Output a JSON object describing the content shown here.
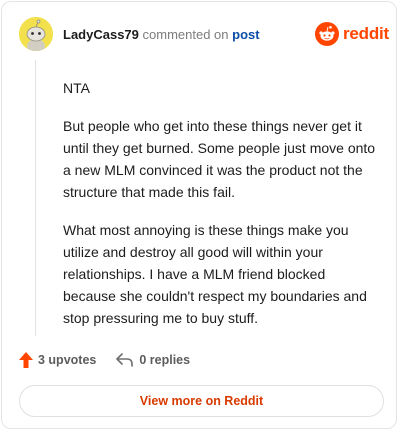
{
  "header": {
    "username": "LadyCass79",
    "action": "commented on",
    "post_link": "post"
  },
  "logo": {
    "wordmark": "reddit",
    "icon": "reddit-snoo-icon"
  },
  "comment": {
    "paragraphs": [
      "NTA",
      "But people who get into these things never get it until they get burned. Some people just move onto a new MLM convinced it was the product not the structure that made this fail.",
      "What most annoying is these things make you utilize and destroy all good will within your relationships. I have a MLM friend blocked because she couldn't respect my boundaries and stop pressuring me to buy stuff."
    ]
  },
  "stats": {
    "upvotes_label": "3 upvotes",
    "replies_label": "0 replies",
    "upvote_icon": "upvote-arrow-icon",
    "reply_icon": "reply-arrow-icon"
  },
  "footer": {
    "view_more_label": "View more on Reddit"
  },
  "colors": {
    "brand": "#ff4500",
    "link": "#0a4ea8",
    "upvote": "#ff4500",
    "cta": "#d93a00"
  }
}
